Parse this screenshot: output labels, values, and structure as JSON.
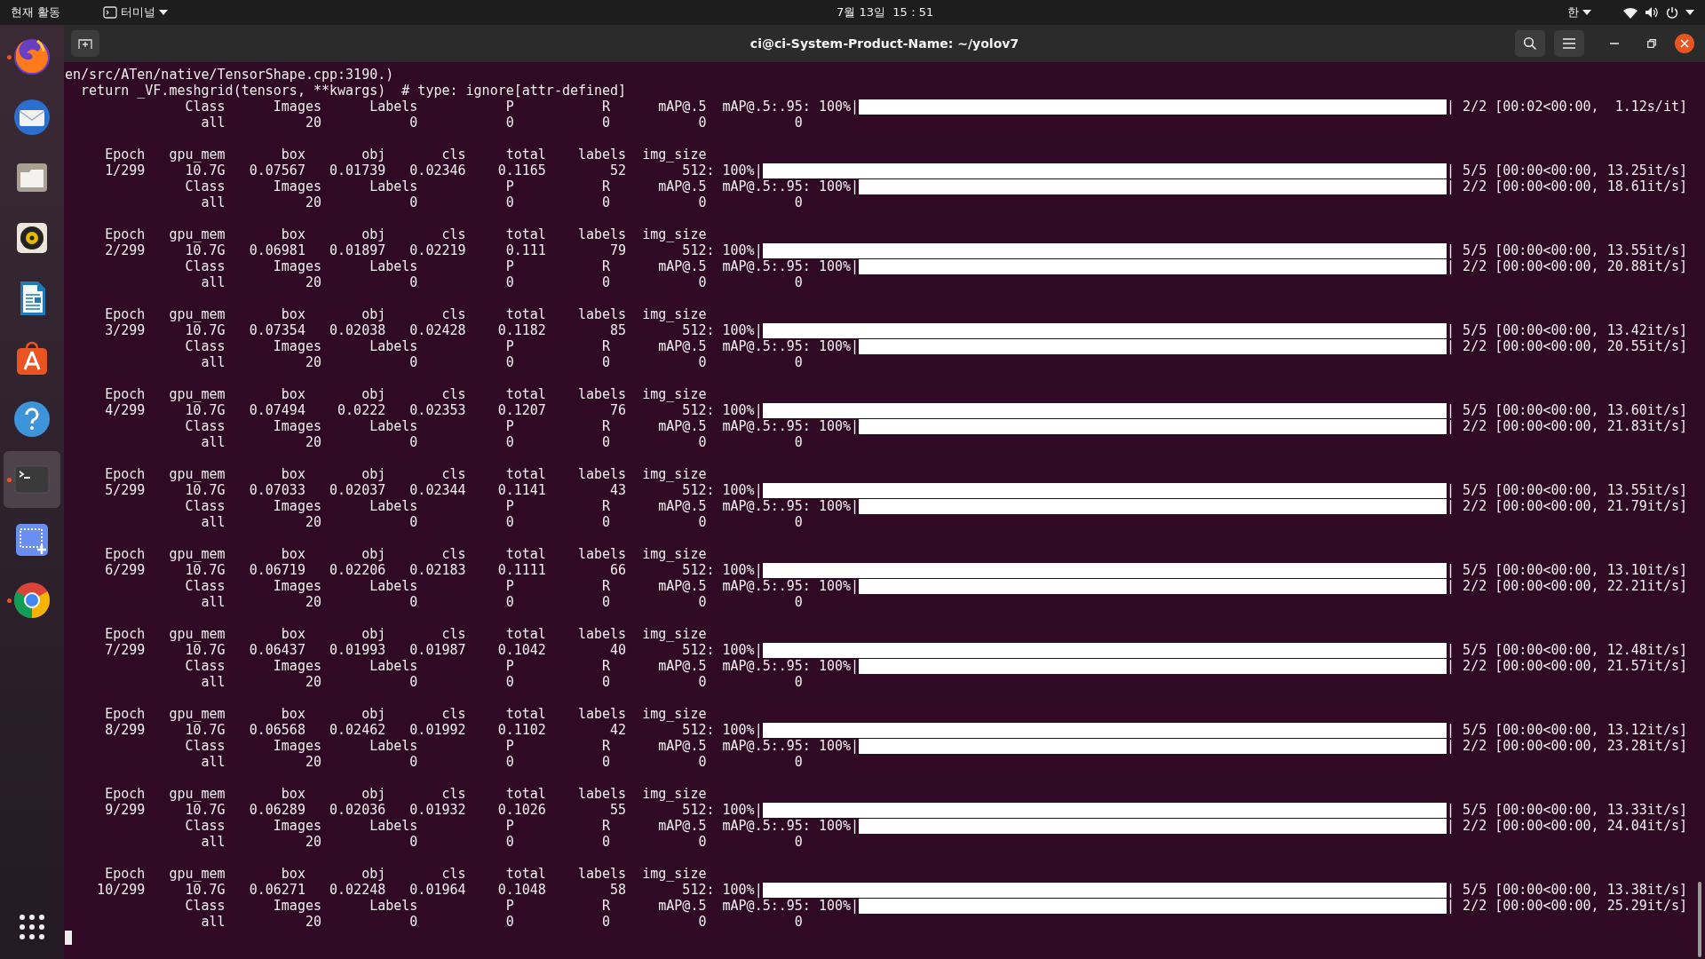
{
  "top_bar": {
    "activities": "현재 활동",
    "app_menu": "터미널",
    "clock": "7월 13일  15：51",
    "input_method": "한"
  },
  "dock": {
    "apps": [
      {
        "kind": "firefox",
        "running": true,
        "selected": false
      },
      {
        "kind": "mail",
        "running": false,
        "selected": false
      },
      {
        "kind": "files",
        "running": false,
        "selected": false
      },
      {
        "kind": "music",
        "running": false,
        "selected": false
      },
      {
        "kind": "writer",
        "running": false,
        "selected": false
      },
      {
        "kind": "store",
        "running": false,
        "selected": false
      },
      {
        "kind": "help",
        "running": false,
        "selected": false
      },
      {
        "kind": "terminal",
        "running": true,
        "selected": true
      },
      {
        "kind": "screenshot",
        "running": false,
        "selected": false
      },
      {
        "kind": "chrome",
        "running": true,
        "selected": false
      }
    ]
  },
  "window": {
    "title": "ci@ci-System-Product-Name: ~/yolov7"
  },
  "terminal": {
    "lines": [
      {
        "kind": "text",
        "text": "en/src/ATen/native/TensorShape.cpp:3190.)"
      },
      {
        "kind": "text",
        "text": "  return _VF.meshgrid(tensors, **kwargs)  # type: ignore[attr-defined]"
      },
      {
        "kind": "val_header",
        "cells": [
          "Class",
          "Images",
          "Labels",
          "P",
          "R",
          "mAP@.5",
          "mAP@.5:.95:"
        ],
        "percent": "100%|",
        "level": 1,
        "stats": "| 2/2 [00:02<00:00,  1.12s/it]"
      },
      {
        "kind": "val",
        "cells": [
          "all",
          "20",
          "0",
          "0",
          "0",
          "0",
          "0"
        ]
      },
      {
        "kind": "blank"
      },
      {
        "kind": "train_header",
        "cells": [
          "Epoch",
          "gpu_mem",
          "box",
          "obj",
          "cls",
          "total",
          "labels",
          "img_size"
        ]
      },
      {
        "kind": "train",
        "cells": [
          "1/299",
          "10.7G",
          "0.07567",
          "0.01739",
          "0.02346",
          "0.1165",
          "52",
          "512:"
        ],
        "percent": "100%|",
        "level": 1,
        "stats": "| 5/5 [00:00<00:00, 13.25it/s]"
      },
      {
        "kind": "val_header",
        "cells": [
          "Class",
          "Images",
          "Labels",
          "P",
          "R",
          "mAP@.5",
          "mAP@.5:.95:"
        ],
        "percent": "100%|",
        "level": 1,
        "stats": "| 2/2 [00:00<00:00, 18.61it/s]"
      },
      {
        "kind": "val",
        "cells": [
          "all",
          "20",
          "0",
          "0",
          "0",
          "0",
          "0"
        ]
      },
      {
        "kind": "blank"
      },
      {
        "kind": "train_header",
        "cells": [
          "Epoch",
          "gpu_mem",
          "box",
          "obj",
          "cls",
          "total",
          "labels",
          "img_size"
        ]
      },
      {
        "kind": "train",
        "cells": [
          "2/299",
          "10.7G",
          "0.06981",
          "0.01897",
          "0.02219",
          "0.111",
          "79",
          "512:"
        ],
        "percent": "100%|",
        "level": 1,
        "stats": "| 5/5 [00:00<00:00, 13.55it/s]"
      },
      {
        "kind": "val_header",
        "cells": [
          "Class",
          "Images",
          "Labels",
          "P",
          "R",
          "mAP@.5",
          "mAP@.5:.95:"
        ],
        "percent": "100%|",
        "level": 1,
        "stats": "| 2/2 [00:00<00:00, 20.88it/s]"
      },
      {
        "kind": "val",
        "cells": [
          "all",
          "20",
          "0",
          "0",
          "0",
          "0",
          "0"
        ]
      },
      {
        "kind": "blank"
      },
      {
        "kind": "train_header",
        "cells": [
          "Epoch",
          "gpu_mem",
          "box",
          "obj",
          "cls",
          "total",
          "labels",
          "img_size"
        ]
      },
      {
        "kind": "train",
        "cells": [
          "3/299",
          "10.7G",
          "0.07354",
          "0.02038",
          "0.02428",
          "0.1182",
          "85",
          "512:"
        ],
        "percent": "100%|",
        "level": 1,
        "stats": "| 5/5 [00:00<00:00, 13.42it/s]"
      },
      {
        "kind": "val_header",
        "cells": [
          "Class",
          "Images",
          "Labels",
          "P",
          "R",
          "mAP@.5",
          "mAP@.5:.95:"
        ],
        "percent": "100%|",
        "level": 1,
        "stats": "| 2/2 [00:00<00:00, 20.55it/s]"
      },
      {
        "kind": "val",
        "cells": [
          "all",
          "20",
          "0",
          "0",
          "0",
          "0",
          "0"
        ]
      },
      {
        "kind": "blank"
      },
      {
        "kind": "train_header",
        "cells": [
          "Epoch",
          "gpu_mem",
          "box",
          "obj",
          "cls",
          "total",
          "labels",
          "img_size"
        ]
      },
      {
        "kind": "train",
        "cells": [
          "4/299",
          "10.7G",
          "0.07494",
          "0.0222",
          "0.02353",
          "0.1207",
          "76",
          "512:"
        ],
        "percent": "100%|",
        "level": 1,
        "stats": "| 5/5 [00:00<00:00, 13.60it/s]"
      },
      {
        "kind": "val_header",
        "cells": [
          "Class",
          "Images",
          "Labels",
          "P",
          "R",
          "mAP@.5",
          "mAP@.5:.95:"
        ],
        "percent": "100%|",
        "level": 1,
        "stats": "| 2/2 [00:00<00:00, 21.83it/s]"
      },
      {
        "kind": "val",
        "cells": [
          "all",
          "20",
          "0",
          "0",
          "0",
          "0",
          "0"
        ]
      },
      {
        "kind": "blank"
      },
      {
        "kind": "train_header",
        "cells": [
          "Epoch",
          "gpu_mem",
          "box",
          "obj",
          "cls",
          "total",
          "labels",
          "img_size"
        ]
      },
      {
        "kind": "train",
        "cells": [
          "5/299",
          "10.7G",
          "0.07033",
          "0.02037",
          "0.02344",
          "0.1141",
          "43",
          "512:"
        ],
        "percent": "100%|",
        "level": 1,
        "stats": "| 5/5 [00:00<00:00, 13.55it/s]"
      },
      {
        "kind": "val_header",
        "cells": [
          "Class",
          "Images",
          "Labels",
          "P",
          "R",
          "mAP@.5",
          "mAP@.5:.95:"
        ],
        "percent": "100%|",
        "level": 1,
        "stats": "| 2/2 [00:00<00:00, 21.79it/s]"
      },
      {
        "kind": "val",
        "cells": [
          "all",
          "20",
          "0",
          "0",
          "0",
          "0",
          "0"
        ]
      },
      {
        "kind": "blank"
      },
      {
        "kind": "train_header",
        "cells": [
          "Epoch",
          "gpu_mem",
          "box",
          "obj",
          "cls",
          "total",
          "labels",
          "img_size"
        ]
      },
      {
        "kind": "train",
        "cells": [
          "6/299",
          "10.7G",
          "0.06719",
          "0.02206",
          "0.02183",
          "0.1111",
          "66",
          "512:"
        ],
        "percent": "100%|",
        "level": 1,
        "stats": "| 5/5 [00:00<00:00, 13.10it/s]"
      },
      {
        "kind": "val_header",
        "cells": [
          "Class",
          "Images",
          "Labels",
          "P",
          "R",
          "mAP@.5",
          "mAP@.5:.95:"
        ],
        "percent": "100%|",
        "level": 1,
        "stats": "| 2/2 [00:00<00:00, 22.21it/s]"
      },
      {
        "kind": "val",
        "cells": [
          "all",
          "20",
          "0",
          "0",
          "0",
          "0",
          "0"
        ]
      },
      {
        "kind": "blank"
      },
      {
        "kind": "train_header",
        "cells": [
          "Epoch",
          "gpu_mem",
          "box",
          "obj",
          "cls",
          "total",
          "labels",
          "img_size"
        ]
      },
      {
        "kind": "train",
        "cells": [
          "7/299",
          "10.7G",
          "0.06437",
          "0.01993",
          "0.01987",
          "0.1042",
          "40",
          "512:"
        ],
        "percent": "100%|",
        "level": 1,
        "stats": "| 5/5 [00:00<00:00, 12.48it/s]"
      },
      {
        "kind": "val_header",
        "cells": [
          "Class",
          "Images",
          "Labels",
          "P",
          "R",
          "mAP@.5",
          "mAP@.5:.95:"
        ],
        "percent": "100%|",
        "level": 1,
        "stats": "| 2/2 [00:00<00:00, 21.57it/s]"
      },
      {
        "kind": "val",
        "cells": [
          "all",
          "20",
          "0",
          "0",
          "0",
          "0",
          "0"
        ]
      },
      {
        "kind": "blank"
      },
      {
        "kind": "train_header",
        "cells": [
          "Epoch",
          "gpu_mem",
          "box",
          "obj",
          "cls",
          "total",
          "labels",
          "img_size"
        ]
      },
      {
        "kind": "train",
        "cells": [
          "8/299",
          "10.7G",
          "0.06568",
          "0.02462",
          "0.01992",
          "0.1102",
          "42",
          "512:"
        ],
        "percent": "100%|",
        "level": 1,
        "stats": "| 5/5 [00:00<00:00, 13.12it/s]"
      },
      {
        "kind": "val_header",
        "cells": [
          "Class",
          "Images",
          "Labels",
          "P",
          "R",
          "mAP@.5",
          "mAP@.5:.95:"
        ],
        "percent": "100%|",
        "level": 1,
        "stats": "| 2/2 [00:00<00:00, 23.28it/s]"
      },
      {
        "kind": "val",
        "cells": [
          "all",
          "20",
          "0",
          "0",
          "0",
          "0",
          "0"
        ]
      },
      {
        "kind": "blank"
      },
      {
        "kind": "train_header",
        "cells": [
          "Epoch",
          "gpu_mem",
          "box",
          "obj",
          "cls",
          "total",
          "labels",
          "img_size"
        ]
      },
      {
        "kind": "train",
        "cells": [
          "9/299",
          "10.7G",
          "0.06289",
          "0.02036",
          "0.01932",
          "0.1026",
          "55",
          "512:"
        ],
        "percent": "100%|",
        "level": 1,
        "stats": "| 5/5 [00:00<00:00, 13.33it/s]"
      },
      {
        "kind": "val_header",
        "cells": [
          "Class",
          "Images",
          "Labels",
          "P",
          "R",
          "mAP@.5",
          "mAP@.5:.95:"
        ],
        "percent": "100%|",
        "level": 1,
        "stats": "| 2/2 [00:00<00:00, 24.04it/s]"
      },
      {
        "kind": "val",
        "cells": [
          "all",
          "20",
          "0",
          "0",
          "0",
          "0",
          "0"
        ]
      },
      {
        "kind": "blank"
      },
      {
        "kind": "train_header",
        "cells": [
          "Epoch",
          "gpu_mem",
          "box",
          "obj",
          "cls",
          "total",
          "labels",
          "img_size"
        ]
      },
      {
        "kind": "train",
        "cells": [
          "10/299",
          "10.7G",
          "0.06271",
          "0.02248",
          "0.01964",
          "0.1048",
          "58",
          "512:"
        ],
        "percent": "100%|",
        "level": 1,
        "stats": "| 5/5 [00:00<00:00, 13.38it/s]"
      },
      {
        "kind": "val_header",
        "cells": [
          "Class",
          "Images",
          "Labels",
          "P",
          "R",
          "mAP@.5",
          "mAP@.5:.95:"
        ],
        "percent": "100%|",
        "level": 1,
        "stats": "| 2/2 [00:00<00:00, 25.29it/s]"
      },
      {
        "kind": "val",
        "cells": [
          "all",
          "20",
          "0",
          "0",
          "0",
          "0",
          "0"
        ]
      }
    ]
  }
}
